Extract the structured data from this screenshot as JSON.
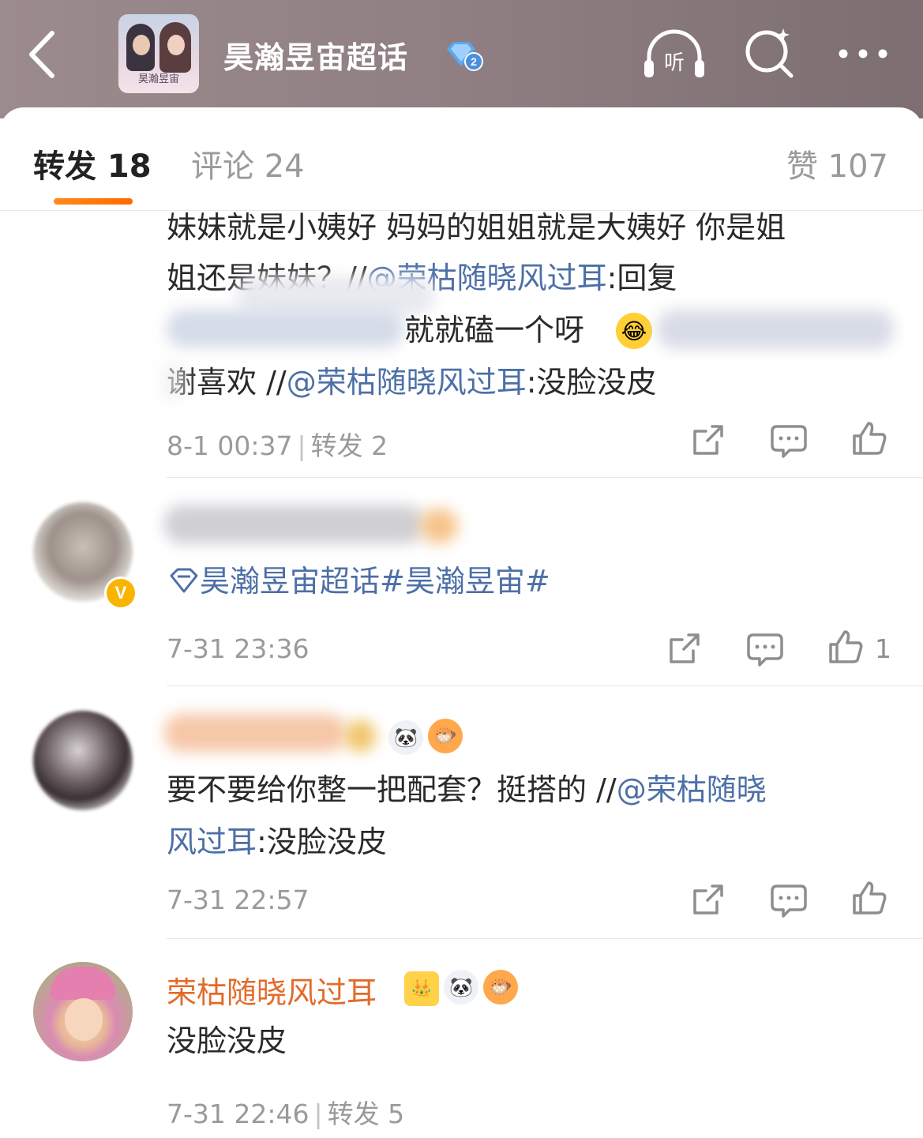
{
  "header": {
    "title": "昊瀚昱宙超话",
    "cover_text": "昊瀚昱宙",
    "listen_label": "听",
    "level": "2"
  },
  "tabs": {
    "repost": "转发 18",
    "comments": "评论 24",
    "likes": "赞 107"
  },
  "posts": [
    {
      "lines": [
        {
          "text": "妹妹就是小姨好 妈妈的姐姐就是大姨好 你是姐"
        },
        {
          "text": "姐还是妹妹？//",
          "mention": "@荣枯随晓风过耳",
          "after": ":回复"
        },
        {
          "text": "",
          "after": "就就磕一个呀"
        },
        {
          "text": "谢喜欢 //",
          "mention": "@荣枯随晓风过耳",
          "after": ":没脸没皮"
        }
      ],
      "time": "8-1 00:37",
      "repost": "转发 2"
    },
    {
      "topic_icon_text": "",
      "topic": "昊瀚昱宙超话#昊瀚昱宙#",
      "time": "7-31 23:36",
      "like_count": "1",
      "verified": "V"
    },
    {
      "lines": [
        {
          "text": "要不要给你整一把配套？挺搭的 //",
          "mention": "@荣枯随晓"
        },
        {
          "mention": "风过耳",
          "after": ":没脸没皮"
        }
      ],
      "time": "7-31 22:57"
    },
    {
      "username": "荣枯随晓风过耳",
      "text": "没脸没皮",
      "time": "7-31 22:46",
      "repost": "转发 5"
    }
  ],
  "colors": {
    "accent": "#ff7a10",
    "link": "#4d6fa7",
    "username": "#e26b2a",
    "header_bg": "#8f7f82"
  },
  "icons": [
    "back-icon",
    "listen-icon",
    "search-icon",
    "more-icon",
    "share-icon",
    "comment-icon",
    "like-icon",
    "supertopic-icon"
  ]
}
